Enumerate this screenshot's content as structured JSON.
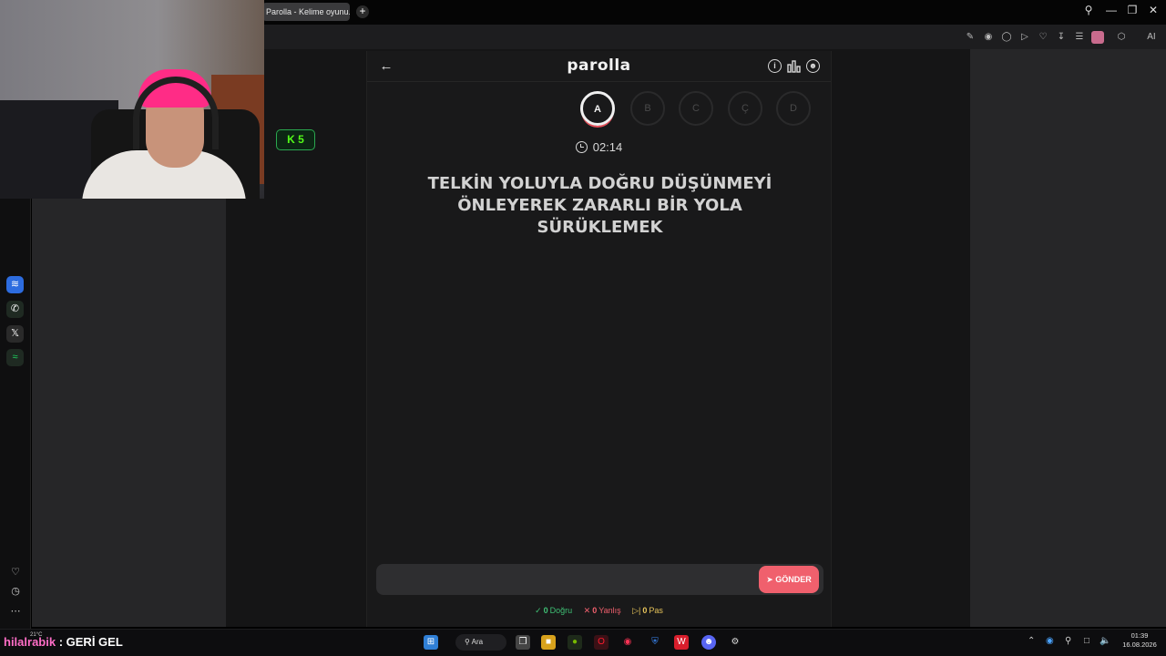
{
  "browser": {
    "tab_title": "Parolla - Kelime oyunu. G",
    "new_tab": "+",
    "toolbar_icons": [
      "edit-icon",
      "camera-icon",
      "shield-icon",
      "play-icon",
      "heart-icon",
      "download-icon",
      "menu-icon",
      "profile-icon",
      "extension-icon",
      "ai-icon"
    ],
    "ai_label": "AI"
  },
  "stream": {
    "kick_count": "5",
    "chat_user": "hilalrabik",
    "chat_message": ": GERİ GEL",
    "weather": "21°C"
  },
  "app": {
    "title": "parolla",
    "letters": [
      "A",
      "B",
      "C",
      "Ç",
      "D"
    ],
    "active_letter": "A",
    "timer": "02:14",
    "question": "TELKİN YOLUYLA DOĞRU DÜŞÜNMEYİ ÖNLEYEREK ZARARLI BİR YOLA SÜRÜKLEMEK",
    "answer": {
      "value": "",
      "placeholder": ""
    },
    "send_label": "GÖNDER",
    "stats": {
      "correct_count": "0",
      "correct_label": "Doğru",
      "wrong_count": "0",
      "wrong_label": "Yanlış",
      "pass_count": "0",
      "pass_label": "Pas"
    },
    "colors": {
      "accent": "#f0606d",
      "correct": "#3fbf74",
      "wrong": "#f0606d",
      "pass": "#e6c35a"
    }
  },
  "taskbar": {
    "search_label": "Ara",
    "time": "01:39",
    "date": "16.08.2026"
  }
}
